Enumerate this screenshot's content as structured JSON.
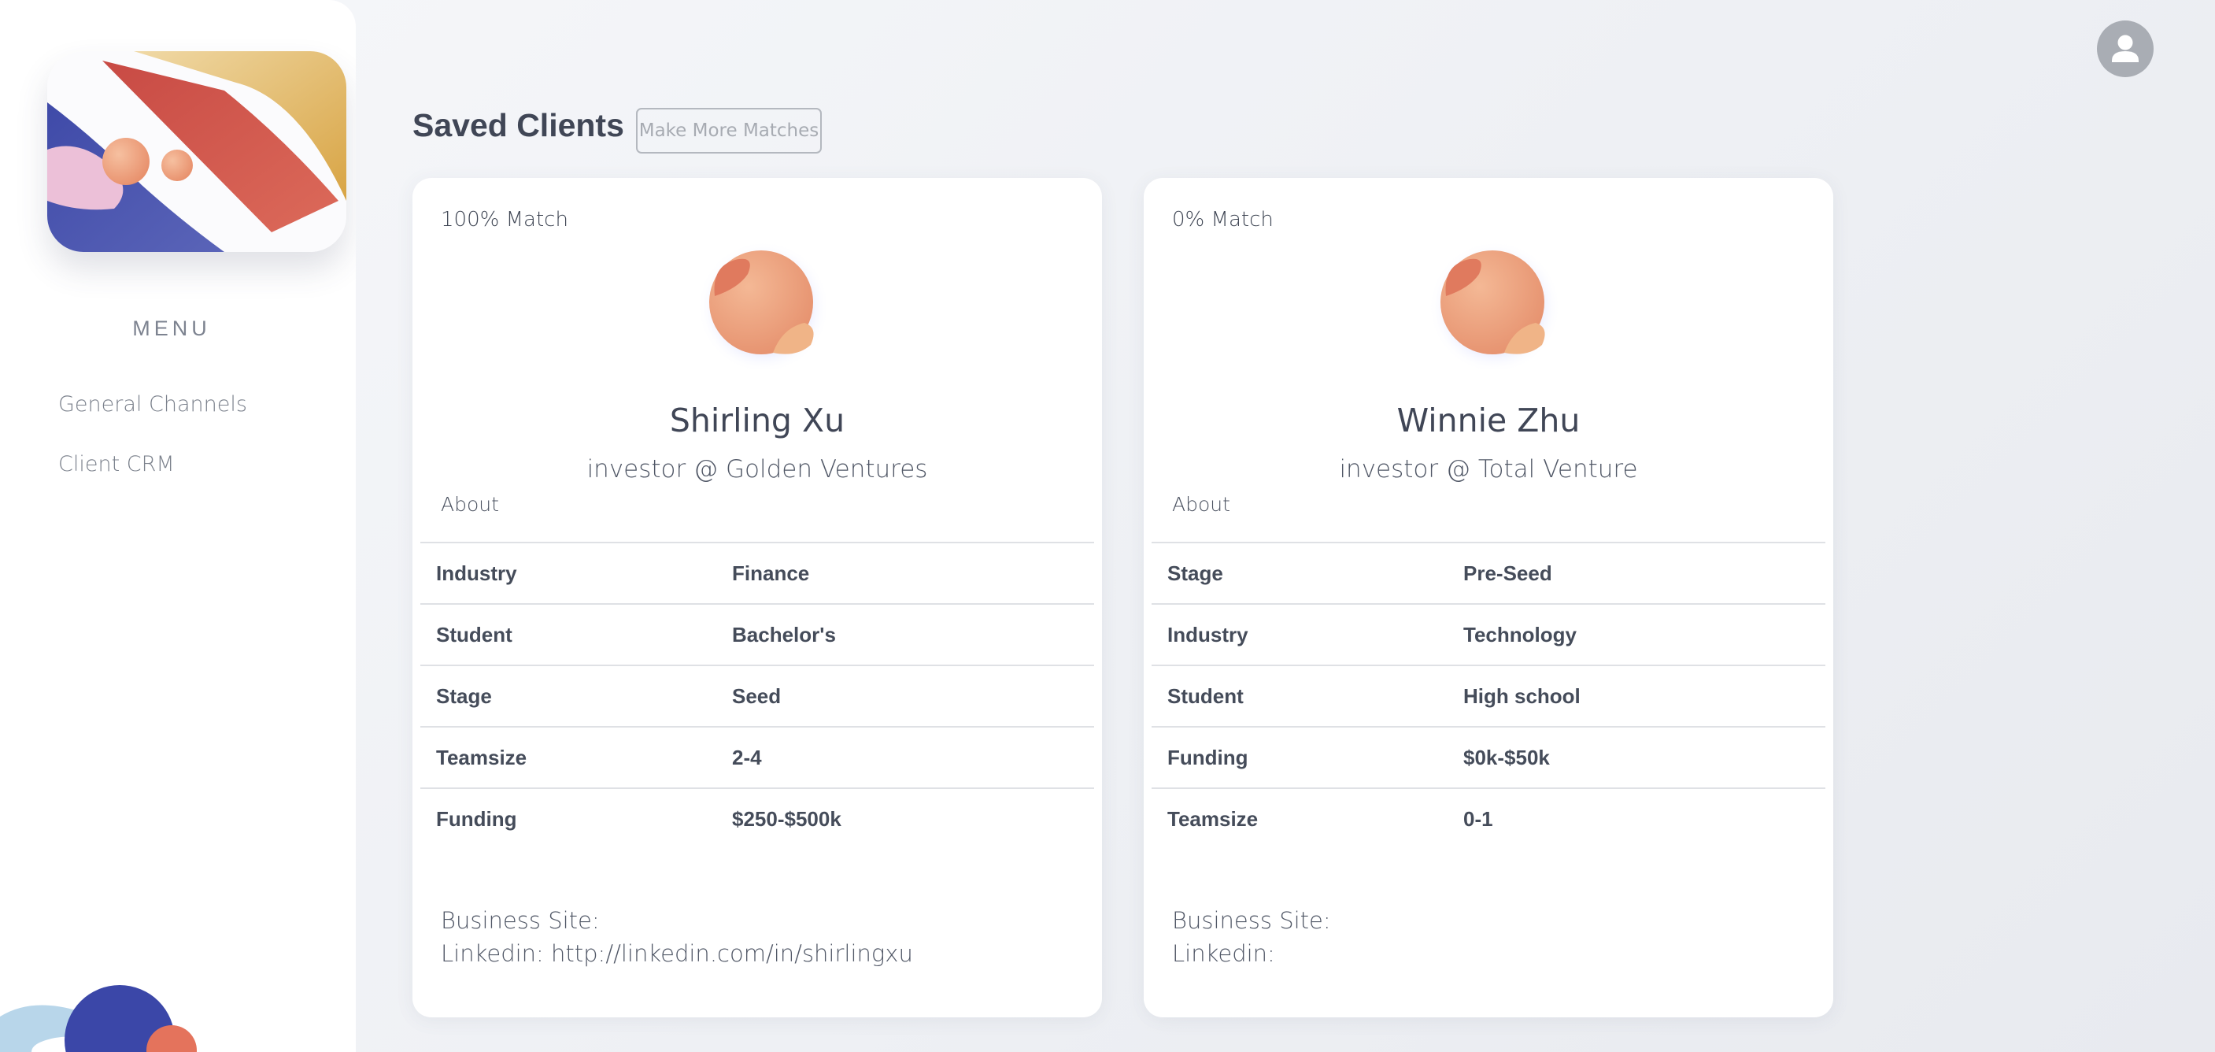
{
  "sidebar": {
    "menu_heading": "MENU",
    "items": [
      {
        "label": "General Channels"
      },
      {
        "label": "Client CRM"
      }
    ]
  },
  "header": {
    "avatar_icon": "user-icon"
  },
  "main": {
    "title": "Saved Clients",
    "make_more_label": "Make More Matches"
  },
  "cards": [
    {
      "match": "100% Match",
      "name": "Shirling Xu",
      "role": "investor @ Golden Ventures",
      "about_label": "About",
      "rows": [
        {
          "key": "Industry",
          "value": "Finance"
        },
        {
          "key": "Student",
          "value": "Bachelor's"
        },
        {
          "key": "Stage",
          "value": "Seed"
        },
        {
          "key": "Teamsize",
          "value": "2-4"
        },
        {
          "key": "Funding",
          "value": "$250-$500k"
        }
      ],
      "business_site_label": "Business Site:",
      "business_site": "",
      "linkedin_label": "Linkedin:",
      "linkedin": "http://linkedin.com/in/shirlingxu"
    },
    {
      "match": "0% Match",
      "name": "Winnie Zhu",
      "role": "investor @ Total Venture",
      "about_label": "About",
      "rows": [
        {
          "key": "Stage",
          "value": "Pre-Seed"
        },
        {
          "key": "Industry",
          "value": "Technology"
        },
        {
          "key": "Student",
          "value": "High school"
        },
        {
          "key": "Funding",
          "value": "$0k-$50k"
        },
        {
          "key": "Teamsize",
          "value": "0-1"
        }
      ],
      "business_site_label": "Business Site:",
      "business_site": "",
      "linkedin_label": "Linkedin:",
      "linkedin": ""
    }
  ],
  "colors": {
    "accent_blue": "#3c48a8",
    "accent_red": "#d2574b",
    "accent_gold": "#e0b65c",
    "avatar_peach": "#eda27f"
  }
}
